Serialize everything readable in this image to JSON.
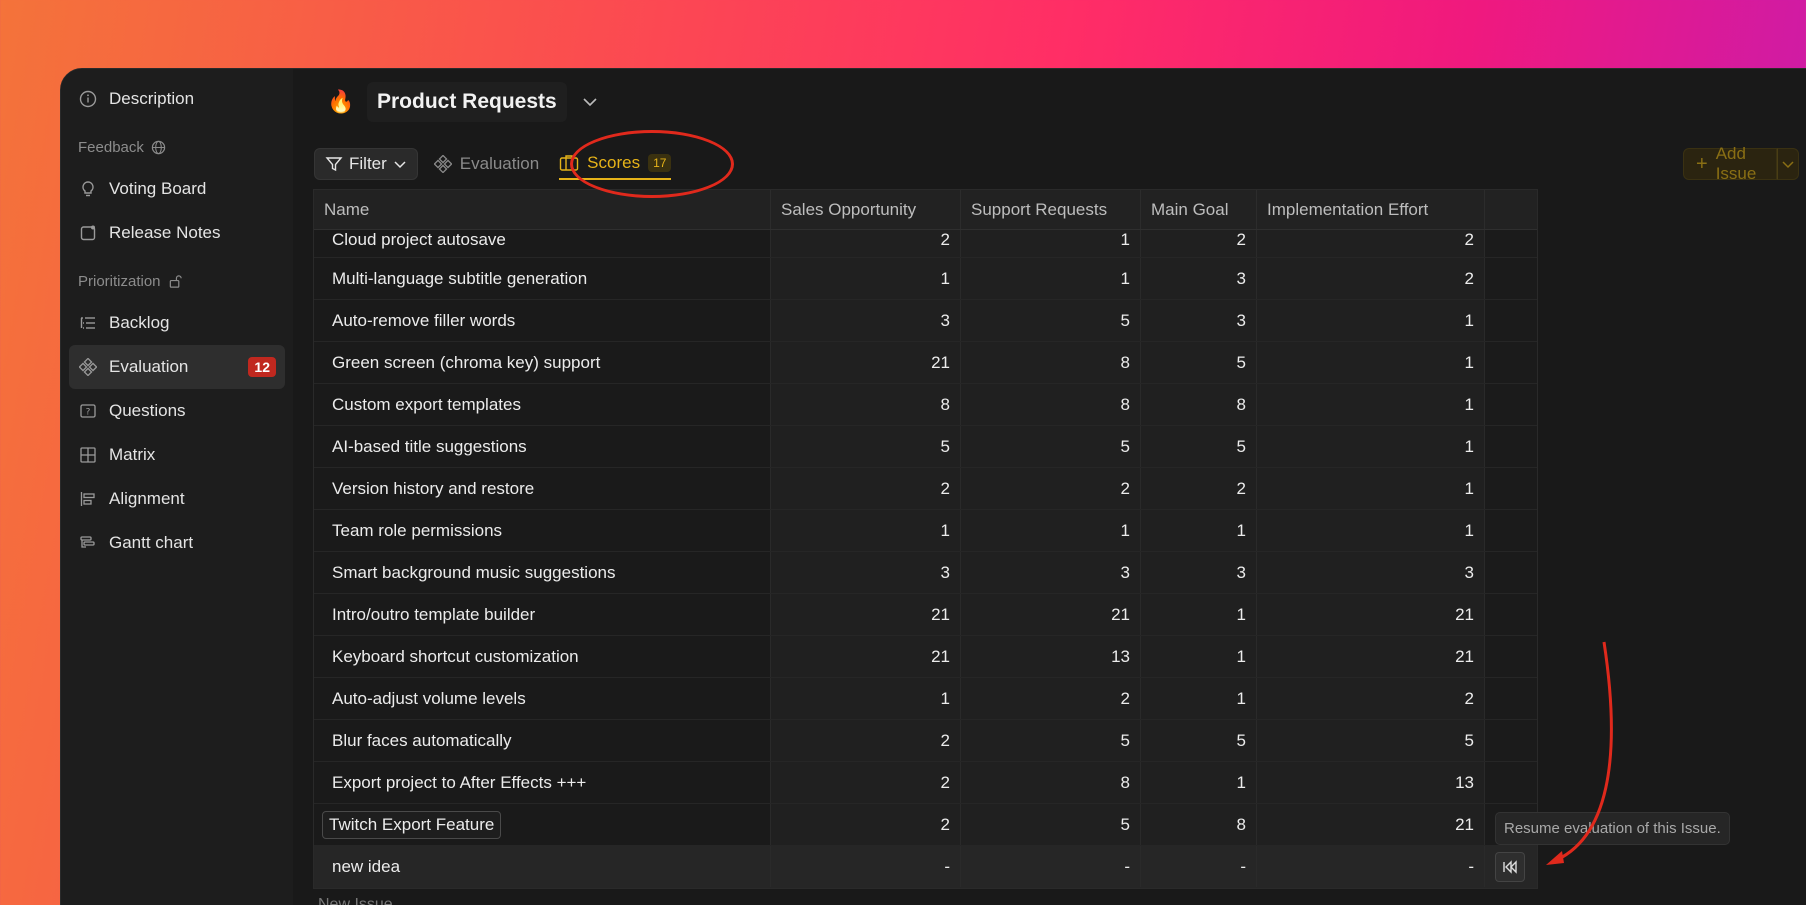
{
  "sidebar": {
    "top_items": [
      {
        "label": "Description",
        "icon": "info-icon"
      }
    ],
    "feedback_label": "Feedback",
    "feedback_items": [
      {
        "label": "Voting Board",
        "icon": "lightbulb-icon"
      },
      {
        "label": "Release Notes",
        "icon": "release-notes-icon"
      }
    ],
    "prioritization_label": "Prioritization",
    "prioritization_items": [
      {
        "label": "Backlog",
        "icon": "backlog-icon"
      },
      {
        "label": "Evaluation",
        "icon": "evaluation-icon",
        "badge": "12",
        "active": true
      },
      {
        "label": "Questions",
        "icon": "question-icon"
      },
      {
        "label": "Matrix",
        "icon": "matrix-icon"
      },
      {
        "label": "Alignment",
        "icon": "alignment-icon"
      },
      {
        "label": "Gantt chart",
        "icon": "gantt-icon"
      }
    ]
  },
  "header": {
    "title": "Product Requests",
    "icon": "fire-icon"
  },
  "toolbar": {
    "filter_label": "Filter",
    "evaluation_tab": "Evaluation",
    "scores_tab": "Scores",
    "scores_count": "17",
    "add_issue_label": "Add Issue"
  },
  "table": {
    "columns": [
      "Name",
      "Sales Opportunity",
      "Support Requests",
      "Main Goal",
      "Implementation Effort"
    ],
    "rows": [
      {
        "name": "Cloud project autosave",
        "values": [
          "2",
          "1",
          "2",
          "2"
        ]
      },
      {
        "name": "Multi-language subtitle generation",
        "values": [
          "1",
          "1",
          "3",
          "2"
        ]
      },
      {
        "name": "Auto-remove filler words",
        "values": [
          "3",
          "5",
          "3",
          "1"
        ]
      },
      {
        "name": "Green screen (chroma key) support",
        "values": [
          "21",
          "8",
          "5",
          "1"
        ]
      },
      {
        "name": "Custom export templates",
        "values": [
          "8",
          "8",
          "8",
          "1"
        ]
      },
      {
        "name": "AI-based title suggestions",
        "values": [
          "5",
          "5",
          "5",
          "1"
        ]
      },
      {
        "name": "Version history and restore",
        "values": [
          "2",
          "2",
          "2",
          "1"
        ]
      },
      {
        "name": "Team role permissions",
        "values": [
          "1",
          "1",
          "1",
          "1"
        ]
      },
      {
        "name": "Smart background music suggestions",
        "values": [
          "3",
          "3",
          "3",
          "3"
        ]
      },
      {
        "name": "Intro/outro template builder",
        "values": [
          "21",
          "21",
          "1",
          "21"
        ]
      },
      {
        "name": "Keyboard shortcut customization",
        "values": [
          "21",
          "13",
          "1",
          "21"
        ]
      },
      {
        "name": "Auto-adjust volume levels",
        "values": [
          "1",
          "2",
          "1",
          "2"
        ]
      },
      {
        "name": "Blur faces automatically",
        "values": [
          "2",
          "5",
          "5",
          "5"
        ]
      },
      {
        "name": "Export project to After Effects +++",
        "values": [
          "2",
          "8",
          "1",
          "13"
        ]
      },
      {
        "name": "Twitch Export Feature",
        "values": [
          "2",
          "5",
          "8",
          "21"
        ],
        "editing": true
      },
      {
        "name": "new idea",
        "values": [
          "-",
          "-",
          "-",
          "-"
        ],
        "highlight": true
      }
    ],
    "new_issue_label": "New Issue"
  },
  "tooltip": {
    "text": "Resume evaluation of this Issue."
  },
  "colors": {
    "accent": "#e6b319",
    "annotation": "#e0291c",
    "badge": "#c0281f"
  }
}
